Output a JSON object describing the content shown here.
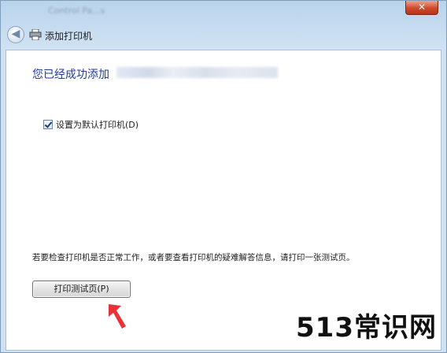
{
  "window": {
    "title_blurred": "Control Pa...s",
    "close_symbol": "✕"
  },
  "nav": {
    "back_symbol": "◀",
    "title": "添加打印机"
  },
  "content": {
    "heading": "您已经成功添加",
    "default_printer_checkbox": {
      "label": "设置为默认打印机(D)",
      "checked": true
    },
    "info_text": "若要检查打印机是否正常工作，或者要查看打印机的疑难解答信息，请打印一张测试页。",
    "print_test_button": "打印测试页(P)"
  },
  "watermark": "513常识网",
  "colors": {
    "heading": "#1f3f9a",
    "annotation_arrow": "#e8323a",
    "close_button": "#cf4a2d"
  }
}
